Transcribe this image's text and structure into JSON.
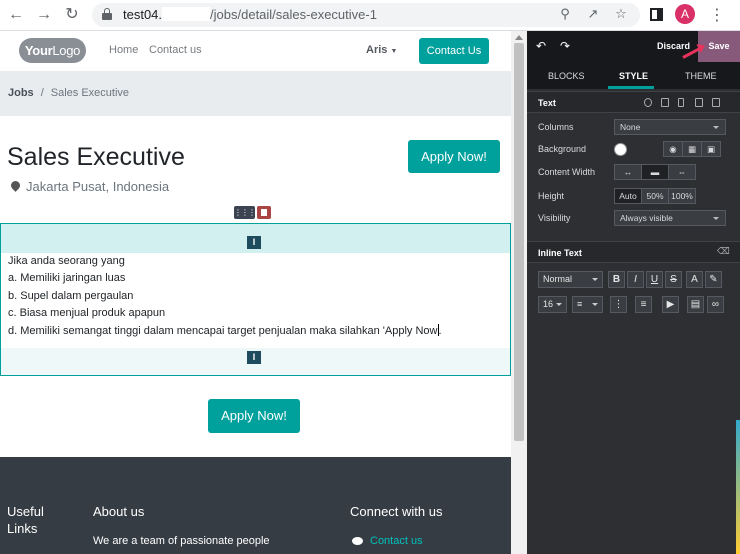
{
  "browser": {
    "url_host": "test04.",
    "url_path": "/jobs/detail/sales-executive-1",
    "avatar_letter": "A"
  },
  "site": {
    "logo_bold": "Your",
    "logo_rest": "Logo",
    "nav": [
      "Home",
      "Contact us"
    ],
    "user": "Aris",
    "header_cta": "Contact Us",
    "breadcrumb": [
      "Jobs",
      "Sales Executive"
    ],
    "job_title": "Sales Executive",
    "location": "Jakarta Pusat, Indonesia",
    "apply_label": "Apply Now!",
    "description": [
      "Jika anda seorang yang",
      "a. Memiliki jaringan luas",
      "b. Supel dalam pergaulan",
      "c. Biasa menjual produk apapun",
      "d. Memiliki semangat tinggi dalam mencapai target penjualan maka silahkan 'Apply Now"
    ],
    "description_tail": ".",
    "footer": {
      "col1": "Useful Links",
      "col2": "About us",
      "col2_text": "We are a team of passionate people",
      "col3": "Connect with us",
      "col3_link": "Contact us"
    }
  },
  "editor": {
    "discard": "Discard",
    "save": "Save",
    "tabs": [
      "BLOCKS",
      "STYLE",
      "THEME"
    ],
    "active_tab": "STYLE",
    "text_section": "Text",
    "columns_label": "Columns",
    "columns_value": "None",
    "background_label": "Background",
    "content_width_label": "Content Width",
    "height_label": "Height",
    "height_options": [
      "Auto",
      "50%",
      "100%"
    ],
    "visibility_label": "Visibility",
    "visibility_value": "Always visible",
    "inline_section": "Inline Text",
    "style_value": "Normal",
    "font_size_value": "16",
    "format_buttons": [
      "B",
      "I",
      "U",
      "S",
      "A"
    ]
  },
  "colors": {
    "primary": "#00a09d",
    "odoo_purple": "#875a7b",
    "editor_bg": "#2d2f33",
    "footer_bg": "#353c43"
  }
}
